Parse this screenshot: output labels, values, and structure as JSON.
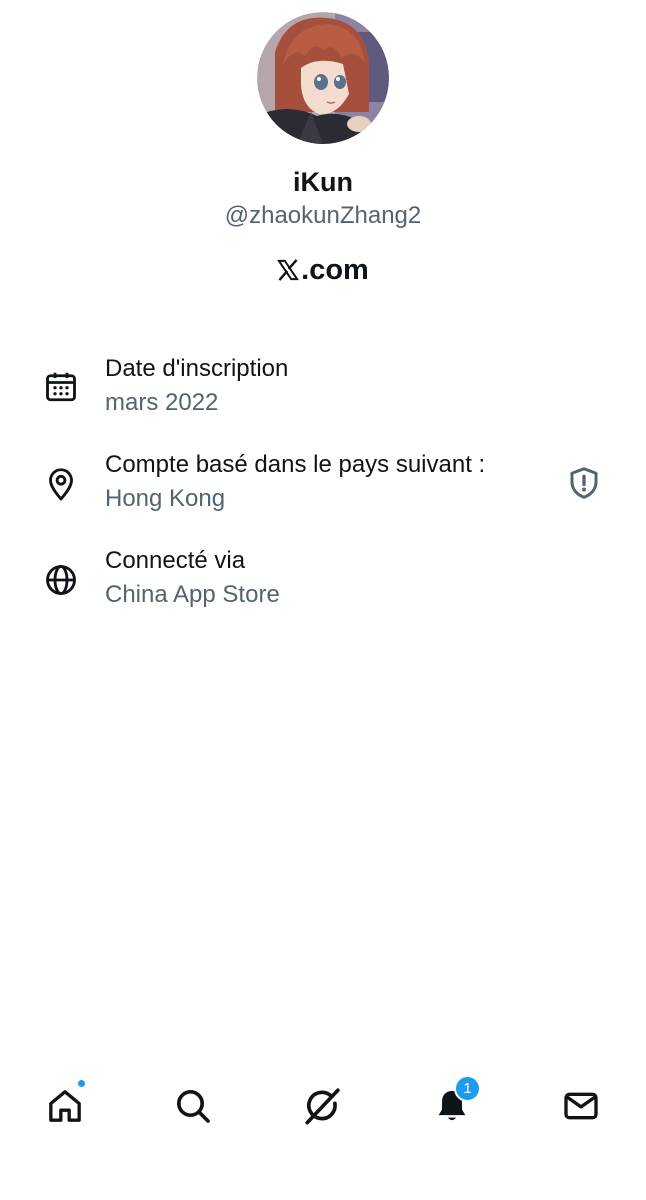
{
  "profile": {
    "display_name": "iKun",
    "handle": "@zhaokunZhang2",
    "site_suffix": ".com",
    "avatar_icon": "avatar-illustration"
  },
  "about": {
    "rows": [
      {
        "icon": "calendar-icon",
        "label": "Date d'inscription",
        "value": "mars 2022"
      },
      {
        "icon": "location-pin-icon",
        "label": "Compte basé dans le pays suivant :",
        "value": "Hong Kong",
        "trailing_icon": "shield-exclamation-icon"
      },
      {
        "icon": "globe-icon",
        "label": "Connecté via",
        "value": "China App Store"
      }
    ]
  },
  "tabbar": {
    "tabs": [
      {
        "name": "home",
        "icon": "home-icon",
        "has_dot": true
      },
      {
        "name": "search",
        "icon": "search-icon"
      },
      {
        "name": "grok",
        "icon": "grok-icon"
      },
      {
        "name": "notifications",
        "icon": "bell-icon",
        "badge": "1"
      },
      {
        "name": "messages",
        "icon": "envelope-icon"
      }
    ]
  },
  "colors": {
    "text_primary": "#0f1419",
    "text_secondary": "#536471",
    "accent": "#1d9bf0",
    "background": "#ffffff"
  }
}
